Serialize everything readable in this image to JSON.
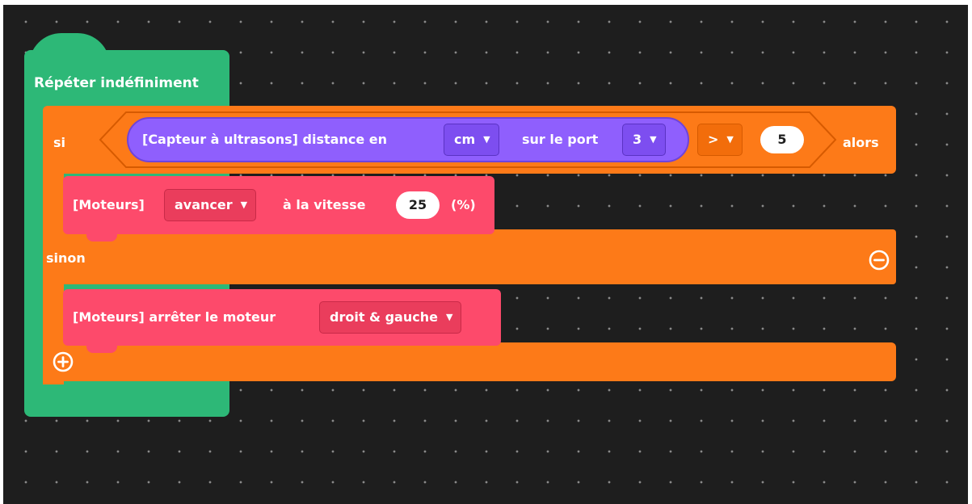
{
  "forever_block": {
    "label": "Répéter indéfiniment"
  },
  "if_block": {
    "if_label": "si",
    "then_label": "alors",
    "else_label": "sinon",
    "sensor": {
      "label": "[Capteur à ultrasons] distance en",
      "unit_value": "cm",
      "port_label": "sur le port",
      "port_value": "3"
    },
    "operator_value": ">",
    "compare_value": "5"
  },
  "motor_forward": {
    "label": "[Moteurs]",
    "direction_value": "avancer",
    "speed_label": "à la vitesse",
    "speed_value": "25",
    "unit_label": "(%)"
  },
  "motor_stop": {
    "label": "[Moteurs] arrêter le moteur",
    "motor_value": "droit & gauche"
  },
  "icons": {
    "dropdown": "caret-down-icon",
    "remove_else": "minus-circle-icon",
    "add_branch": "plus-circle-icon"
  },
  "colors": {
    "workspace": "#1e1e1e",
    "control_loop": "#2db877",
    "control_if": "#fd7a18",
    "sensor": "#8f5ffd",
    "motor": "#fd4a6b"
  }
}
